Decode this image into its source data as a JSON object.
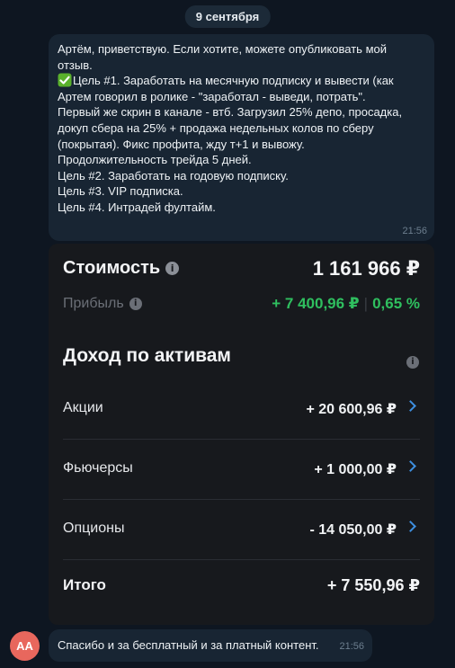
{
  "date_pill": "9 сентября",
  "message": {
    "lines": [
      "Артём, приветствую. Если хотите, можете опубликовать мой",
      "отзыв.",
      "",
      "Цель #1. Заработать на месячную подписку и вывести (как",
      "Артем говорил в ролике - \"заработал - выведи, потрать\".",
      "Первый же скрин в канале - втб. Загрузил 25% депо, просадка,",
      "докуп сбера на 25% + продажа недельных колов по сберу",
      "(покрытая). Фикс профита, жду т+1 и вывожу.",
      "Продолжительность трейда 5 дней.",
      "Цель #2. Заработать на годовую подписку.",
      "Цель #3. VIP подписка.",
      "Цель #4. Интрадей фултайм."
    ],
    "emoji_icon": "check-mark-button-icon",
    "time": "21:56"
  },
  "card": {
    "cost_label": "Стоимость",
    "cost_value": "1 161 966 ₽",
    "profit_label": "Прибыль",
    "profit_value": "+ 7 400,96 ₽",
    "profit_percent": "0,65 %",
    "profit_color": "#2fbf5f",
    "section_title": "Доход по активам",
    "assets": [
      {
        "label": "Акции",
        "value": "+ 20 600,96 ₽"
      },
      {
        "label": "Фьючерсы",
        "value": "+ 1 000,00 ₽"
      },
      {
        "label": "Опционы",
        "value": "- 14 050,00 ₽"
      }
    ],
    "total_label": "Итого",
    "total_value": "+ 7 550,96 ₽",
    "accent_color": "#3d8fe0"
  },
  "reply": {
    "avatar_initials": "AA",
    "avatar_color": "#e8675d",
    "text": "Спасибо и за бесплатный и за платный контент.",
    "time": "21:56"
  }
}
